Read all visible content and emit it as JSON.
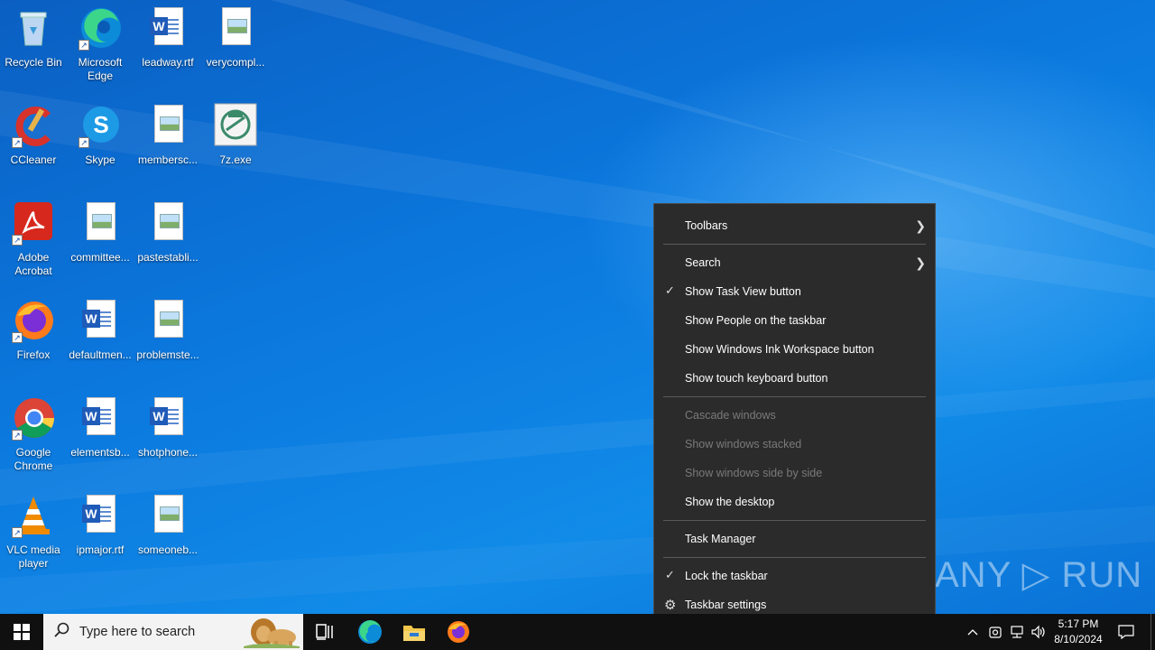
{
  "desktop": {
    "icons": [
      {
        "label": "Recycle Bin"
      },
      {
        "label": "Microsoft Edge"
      },
      {
        "label": "leadway.rtf"
      },
      {
        "label": "verycompl..."
      },
      {
        "label": "CCleaner"
      },
      {
        "label": "Skype"
      },
      {
        "label": "membersc..."
      },
      {
        "label": "7z.exe"
      },
      {
        "label": "Adobe Acrobat"
      },
      {
        "label": "committee..."
      },
      {
        "label": "pastestabli..."
      },
      {
        "label": "Firefox"
      },
      {
        "label": "defaultmen..."
      },
      {
        "label": "problemste..."
      },
      {
        "label": "Google Chrome"
      },
      {
        "label": "elementsb..."
      },
      {
        "label": "shotphone..."
      },
      {
        "label": "VLC media player"
      },
      {
        "label": "ipmajor.rtf"
      },
      {
        "label": "someoneb..."
      }
    ]
  },
  "context_menu": {
    "toolbars": "Toolbars",
    "search": "Search",
    "show_task_view": "Show Task View button",
    "show_people": "Show People on the taskbar",
    "show_ink": "Show Windows Ink Workspace button",
    "show_touch_keyboard": "Show touch keyboard button",
    "cascade": "Cascade windows",
    "stacked": "Show windows stacked",
    "side_by_side": "Show windows side by side",
    "show_desktop": "Show the desktop",
    "task_manager": "Task Manager",
    "lock_taskbar": "Lock the taskbar",
    "taskbar_settings": "Taskbar settings",
    "check_glyph": "✓"
  },
  "watermark": "ANY ▷ RUN",
  "taskbar": {
    "search_placeholder": "Type here to search",
    "clock_time": "5:17 PM",
    "clock_date": "8/10/2024"
  },
  "colors": {
    "menu_bg": "#2b2b2b",
    "taskbar_bg": "#101010",
    "desktop_accent": "#0b78de"
  }
}
